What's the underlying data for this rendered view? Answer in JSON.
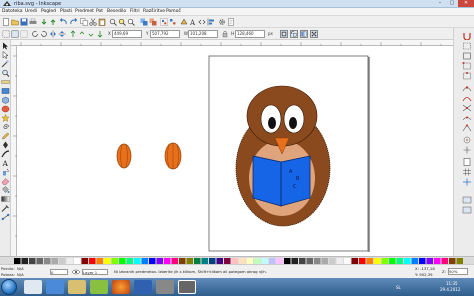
{
  "window": {
    "title": "riba.svg - Inkscape",
    "controls": [
      "–",
      "▢",
      "✕"
    ]
  },
  "menu": [
    "Datoteka",
    "Uredi",
    "Pogled",
    "Plasti",
    "Predmet",
    "Pot",
    "Besedilo",
    "Filtri",
    "Razširitve",
    "Pomoč"
  ],
  "toolbar2": {
    "x_label": "X",
    "x_value": "449,69",
    "y_label": "Y",
    "y_value": "507,792",
    "w_label": "W",
    "w_value": "101,208",
    "h_label": "H",
    "h_value": "128,460",
    "unit": "px"
  },
  "status": {
    "fill_label": "Polnilo:",
    "fill_value": "N/A",
    "stroke_label": "Poteza:",
    "stroke_value": "N/A",
    "opacity": "0",
    "layer": "Layer 1",
    "message": "Ni izbranih predmetov. Izberite jih s klikom, Shift+klikom ali potegom okrog njih.",
    "cursor_x": "X: -137,18",
    "cursor_y": "Y: 902,39",
    "zoom_label": "Z:",
    "zoom": "50%"
  },
  "tray": {
    "lang": "SL",
    "time": "11:35",
    "date": "29.4.2012"
  },
  "colors": {
    "owl_body": "#8b4a1e",
    "owl_belly": "#e0a47c",
    "book": "#1565e6",
    "orange_shape": "#e8701a"
  },
  "book": {
    "letters": [
      "A",
      "B",
      "C"
    ]
  },
  "icons": {
    "toolbox": [
      "selector-arrow-icon",
      "node-tool-icon",
      "tweak-icon",
      "zoom-icon",
      "measure-icon",
      "rectangle-icon",
      "3d-box-icon",
      "ellipse-icon",
      "star-icon",
      "spiral-icon",
      "pencil-icon",
      "pen-icon",
      "calligraphy-icon",
      "text-icon",
      "spray-icon",
      "eraser-icon",
      "bucket-icon",
      "gradient-icon",
      "dropper-icon",
      "connector-icon"
    ]
  }
}
